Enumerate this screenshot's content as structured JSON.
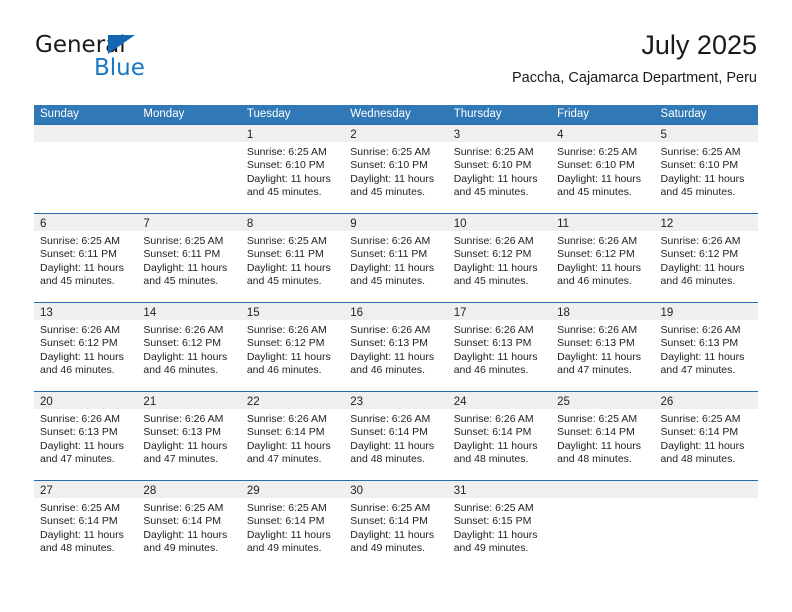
{
  "logo": {
    "word_top": "General",
    "word_bottom": "Blue",
    "triangle_color": "#1567b5",
    "blue_text_color": "#1878c8"
  },
  "header": {
    "title": "July 2025",
    "subtitle": "Paccha, Cajamarca Department, Peru"
  },
  "theme": {
    "header_band": "#3178b6",
    "week_divider": "#2a6eb0",
    "day_strip": "#efefef",
    "text": "#222222"
  },
  "weekdays": [
    "Sunday",
    "Monday",
    "Tuesday",
    "Wednesday",
    "Thursday",
    "Friday",
    "Saturday"
  ],
  "weeks": [
    [
      {
        "day": "",
        "empty": true
      },
      {
        "day": "",
        "empty": true
      },
      {
        "day": "1",
        "sunrise": "Sunrise: 6:25 AM",
        "sunset": "Sunset: 6:10 PM",
        "daylight1": "Daylight: 11 hours",
        "daylight2": "and 45 minutes."
      },
      {
        "day": "2",
        "sunrise": "Sunrise: 6:25 AM",
        "sunset": "Sunset: 6:10 PM",
        "daylight1": "Daylight: 11 hours",
        "daylight2": "and 45 minutes."
      },
      {
        "day": "3",
        "sunrise": "Sunrise: 6:25 AM",
        "sunset": "Sunset: 6:10 PM",
        "daylight1": "Daylight: 11 hours",
        "daylight2": "and 45 minutes."
      },
      {
        "day": "4",
        "sunrise": "Sunrise: 6:25 AM",
        "sunset": "Sunset: 6:10 PM",
        "daylight1": "Daylight: 11 hours",
        "daylight2": "and 45 minutes."
      },
      {
        "day": "5",
        "sunrise": "Sunrise: 6:25 AM",
        "sunset": "Sunset: 6:10 PM",
        "daylight1": "Daylight: 11 hours",
        "daylight2": "and 45 minutes."
      }
    ],
    [
      {
        "day": "6",
        "sunrise": "Sunrise: 6:25 AM",
        "sunset": "Sunset: 6:11 PM",
        "daylight1": "Daylight: 11 hours",
        "daylight2": "and 45 minutes."
      },
      {
        "day": "7",
        "sunrise": "Sunrise: 6:25 AM",
        "sunset": "Sunset: 6:11 PM",
        "daylight1": "Daylight: 11 hours",
        "daylight2": "and 45 minutes."
      },
      {
        "day": "8",
        "sunrise": "Sunrise: 6:25 AM",
        "sunset": "Sunset: 6:11 PM",
        "daylight1": "Daylight: 11 hours",
        "daylight2": "and 45 minutes."
      },
      {
        "day": "9",
        "sunrise": "Sunrise: 6:26 AM",
        "sunset": "Sunset: 6:11 PM",
        "daylight1": "Daylight: 11 hours",
        "daylight2": "and 45 minutes."
      },
      {
        "day": "10",
        "sunrise": "Sunrise: 6:26 AM",
        "sunset": "Sunset: 6:12 PM",
        "daylight1": "Daylight: 11 hours",
        "daylight2": "and 45 minutes."
      },
      {
        "day": "11",
        "sunrise": "Sunrise: 6:26 AM",
        "sunset": "Sunset: 6:12 PM",
        "daylight1": "Daylight: 11 hours",
        "daylight2": "and 46 minutes."
      },
      {
        "day": "12",
        "sunrise": "Sunrise: 6:26 AM",
        "sunset": "Sunset: 6:12 PM",
        "daylight1": "Daylight: 11 hours",
        "daylight2": "and 46 minutes."
      }
    ],
    [
      {
        "day": "13",
        "sunrise": "Sunrise: 6:26 AM",
        "sunset": "Sunset: 6:12 PM",
        "daylight1": "Daylight: 11 hours",
        "daylight2": "and 46 minutes."
      },
      {
        "day": "14",
        "sunrise": "Sunrise: 6:26 AM",
        "sunset": "Sunset: 6:12 PM",
        "daylight1": "Daylight: 11 hours",
        "daylight2": "and 46 minutes."
      },
      {
        "day": "15",
        "sunrise": "Sunrise: 6:26 AM",
        "sunset": "Sunset: 6:12 PM",
        "daylight1": "Daylight: 11 hours",
        "daylight2": "and 46 minutes."
      },
      {
        "day": "16",
        "sunrise": "Sunrise: 6:26 AM",
        "sunset": "Sunset: 6:13 PM",
        "daylight1": "Daylight: 11 hours",
        "daylight2": "and 46 minutes."
      },
      {
        "day": "17",
        "sunrise": "Sunrise: 6:26 AM",
        "sunset": "Sunset: 6:13 PM",
        "daylight1": "Daylight: 11 hours",
        "daylight2": "and 46 minutes."
      },
      {
        "day": "18",
        "sunrise": "Sunrise: 6:26 AM",
        "sunset": "Sunset: 6:13 PM",
        "daylight1": "Daylight: 11 hours",
        "daylight2": "and 47 minutes."
      },
      {
        "day": "19",
        "sunrise": "Sunrise: 6:26 AM",
        "sunset": "Sunset: 6:13 PM",
        "daylight1": "Daylight: 11 hours",
        "daylight2": "and 47 minutes."
      }
    ],
    [
      {
        "day": "20",
        "sunrise": "Sunrise: 6:26 AM",
        "sunset": "Sunset: 6:13 PM",
        "daylight1": "Daylight: 11 hours",
        "daylight2": "and 47 minutes."
      },
      {
        "day": "21",
        "sunrise": "Sunrise: 6:26 AM",
        "sunset": "Sunset: 6:13 PM",
        "daylight1": "Daylight: 11 hours",
        "daylight2": "and 47 minutes."
      },
      {
        "day": "22",
        "sunrise": "Sunrise: 6:26 AM",
        "sunset": "Sunset: 6:14 PM",
        "daylight1": "Daylight: 11 hours",
        "daylight2": "and 47 minutes."
      },
      {
        "day": "23",
        "sunrise": "Sunrise: 6:26 AM",
        "sunset": "Sunset: 6:14 PM",
        "daylight1": "Daylight: 11 hours",
        "daylight2": "and 48 minutes."
      },
      {
        "day": "24",
        "sunrise": "Sunrise: 6:26 AM",
        "sunset": "Sunset: 6:14 PM",
        "daylight1": "Daylight: 11 hours",
        "daylight2": "and 48 minutes."
      },
      {
        "day": "25",
        "sunrise": "Sunrise: 6:25 AM",
        "sunset": "Sunset: 6:14 PM",
        "daylight1": "Daylight: 11 hours",
        "daylight2": "and 48 minutes."
      },
      {
        "day": "26",
        "sunrise": "Sunrise: 6:25 AM",
        "sunset": "Sunset: 6:14 PM",
        "daylight1": "Daylight: 11 hours",
        "daylight2": "and 48 minutes."
      }
    ],
    [
      {
        "day": "27",
        "sunrise": "Sunrise: 6:25 AM",
        "sunset": "Sunset: 6:14 PM",
        "daylight1": "Daylight: 11 hours",
        "daylight2": "and 48 minutes."
      },
      {
        "day": "28",
        "sunrise": "Sunrise: 6:25 AM",
        "sunset": "Sunset: 6:14 PM",
        "daylight1": "Daylight: 11 hours",
        "daylight2": "and 49 minutes."
      },
      {
        "day": "29",
        "sunrise": "Sunrise: 6:25 AM",
        "sunset": "Sunset: 6:14 PM",
        "daylight1": "Daylight: 11 hours",
        "daylight2": "and 49 minutes."
      },
      {
        "day": "30",
        "sunrise": "Sunrise: 6:25 AM",
        "sunset": "Sunset: 6:14 PM",
        "daylight1": "Daylight: 11 hours",
        "daylight2": "and 49 minutes."
      },
      {
        "day": "31",
        "sunrise": "Sunrise: 6:25 AM",
        "sunset": "Sunset: 6:15 PM",
        "daylight1": "Daylight: 11 hours",
        "daylight2": "and 49 minutes."
      },
      {
        "day": "",
        "empty": true
      },
      {
        "day": "",
        "empty": true
      }
    ]
  ]
}
